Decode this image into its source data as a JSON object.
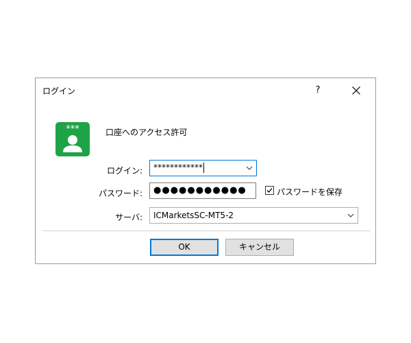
{
  "dialog": {
    "title": "ログイン",
    "help_label": "?",
    "header": "口座へのアクセス許可",
    "icon_mask_text": "***",
    "fields": {
      "login_label": "ログイン:",
      "login_value": "************",
      "password_label": "パスワード:",
      "password_value": "●●●●●●●●●●●",
      "save_password_label": "パスワードを保存",
      "save_password_checked": true,
      "server_label": "サーバ:",
      "server_value": "ICMarketsSC-MT5-2"
    },
    "buttons": {
      "ok": "OK",
      "cancel": "キャンセル"
    }
  },
  "colors": {
    "accent": "#0078d7",
    "icon_green": "#1fa347"
  }
}
